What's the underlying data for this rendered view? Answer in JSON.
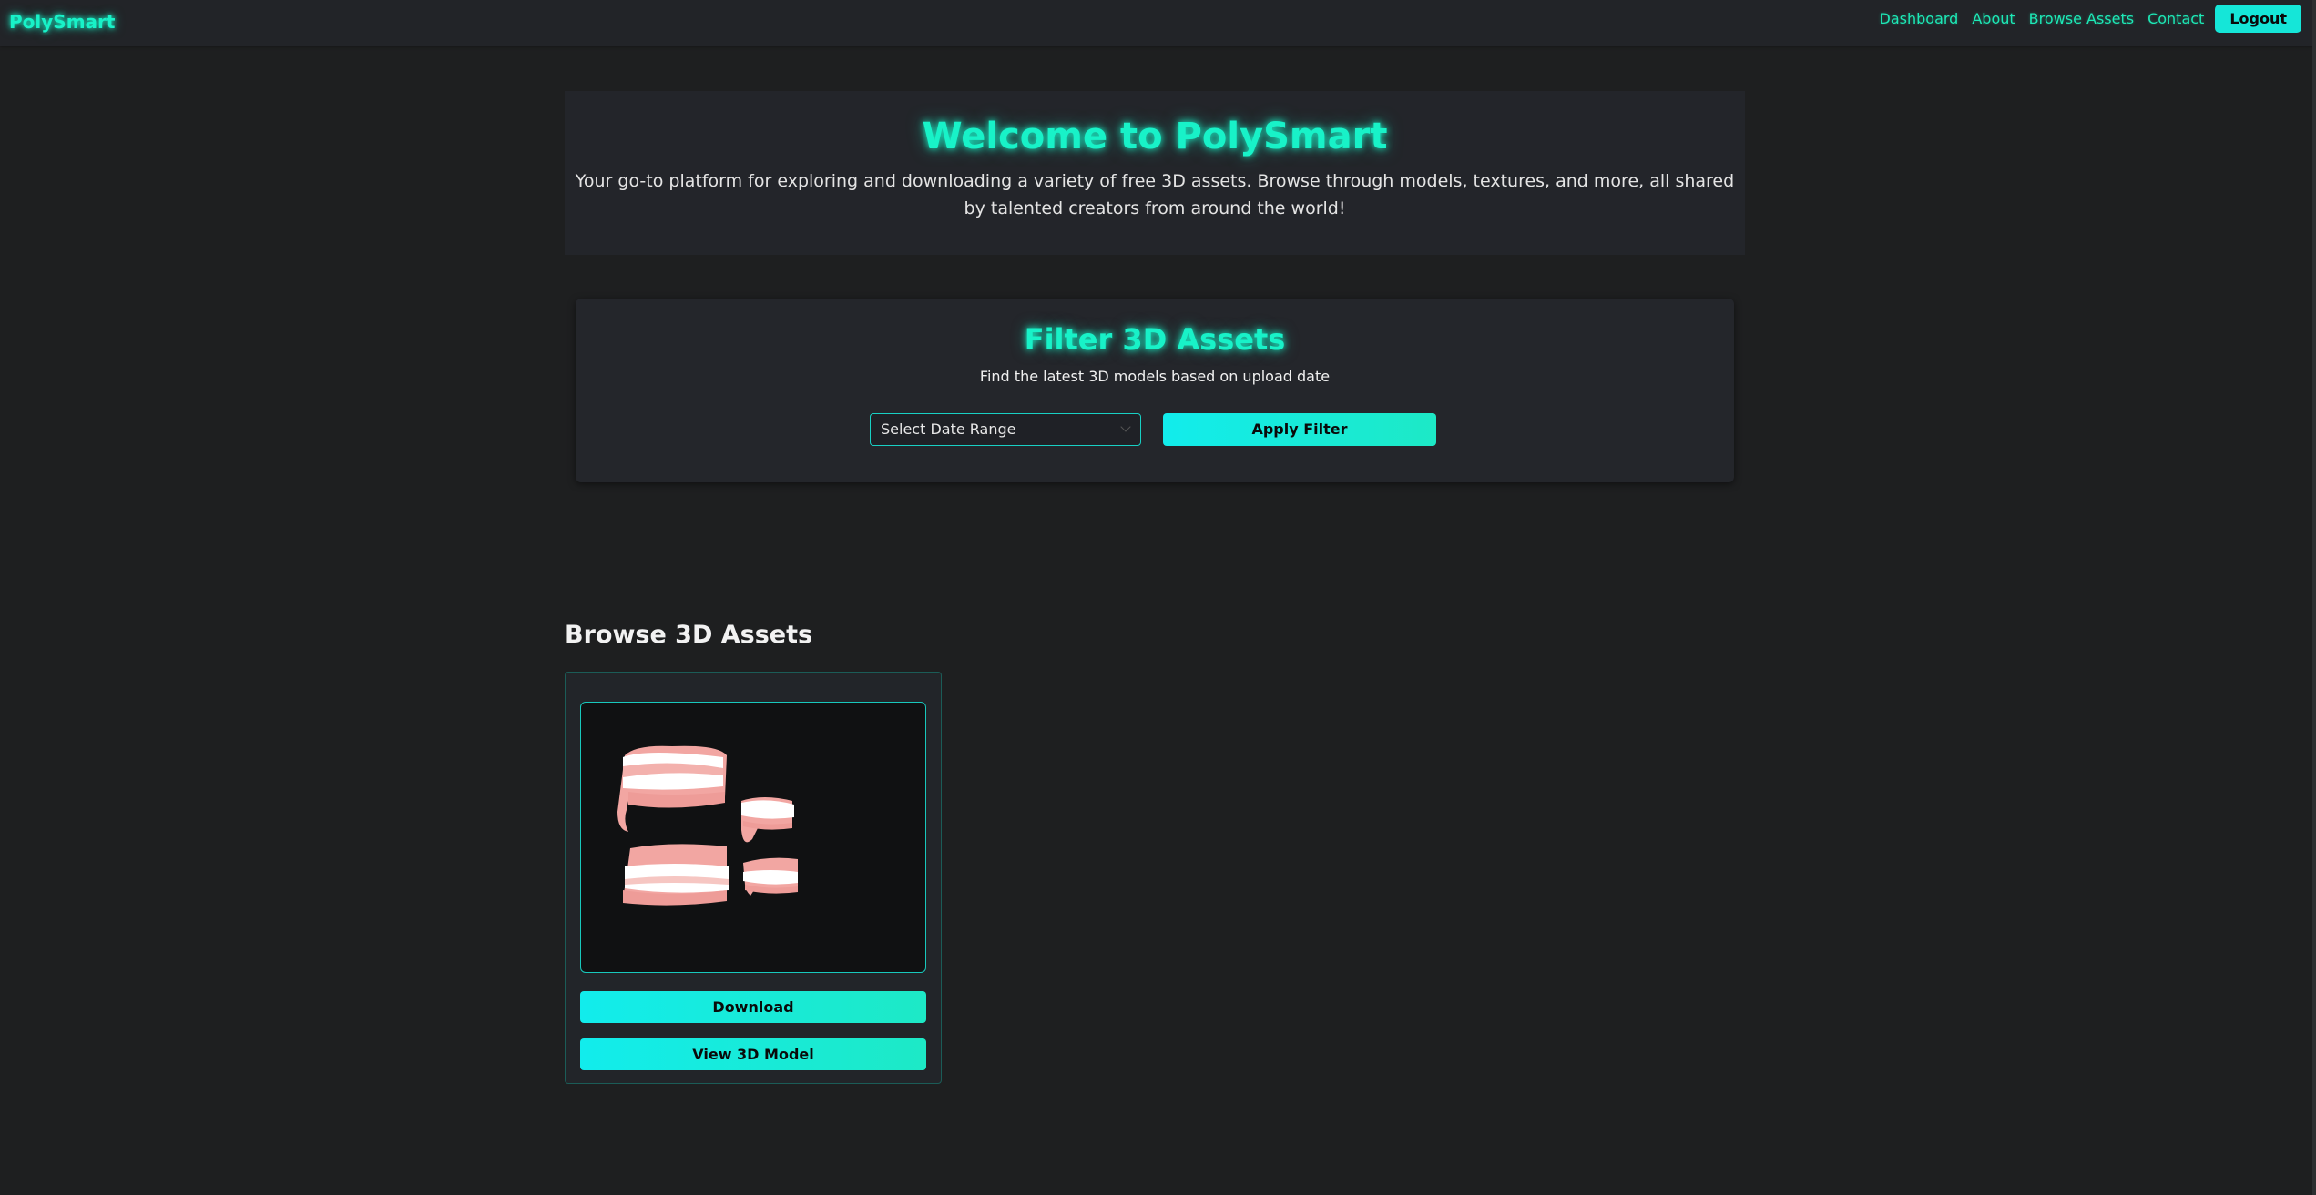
{
  "nav": {
    "brand": "PolySmart",
    "links": [
      "Dashboard",
      "About",
      "Browse Assets",
      "Contact"
    ],
    "logout": "Logout"
  },
  "hero": {
    "title": "Welcome to PolySmart",
    "text": "Your go-to platform for exploring and downloading a variety of free 3D assets. Browse through models, textures, and more, all shared by talented creators from around the world!"
  },
  "filter": {
    "title": "Filter 3D Assets",
    "subtitle": "Find the latest 3D models based on upload date",
    "select_value": "Select Date Range",
    "apply_label": "Apply Filter"
  },
  "browse": {
    "title": "Browse 3D Assets",
    "assets": [
      {
        "preview": "teeth-model-icon",
        "download_label": "Download",
        "view_label": "View 3D Model"
      }
    ]
  },
  "colors": {
    "accent": "#18f2c8",
    "button": "#12ecec",
    "background": "#1e1f20",
    "panel": "#23252a"
  }
}
